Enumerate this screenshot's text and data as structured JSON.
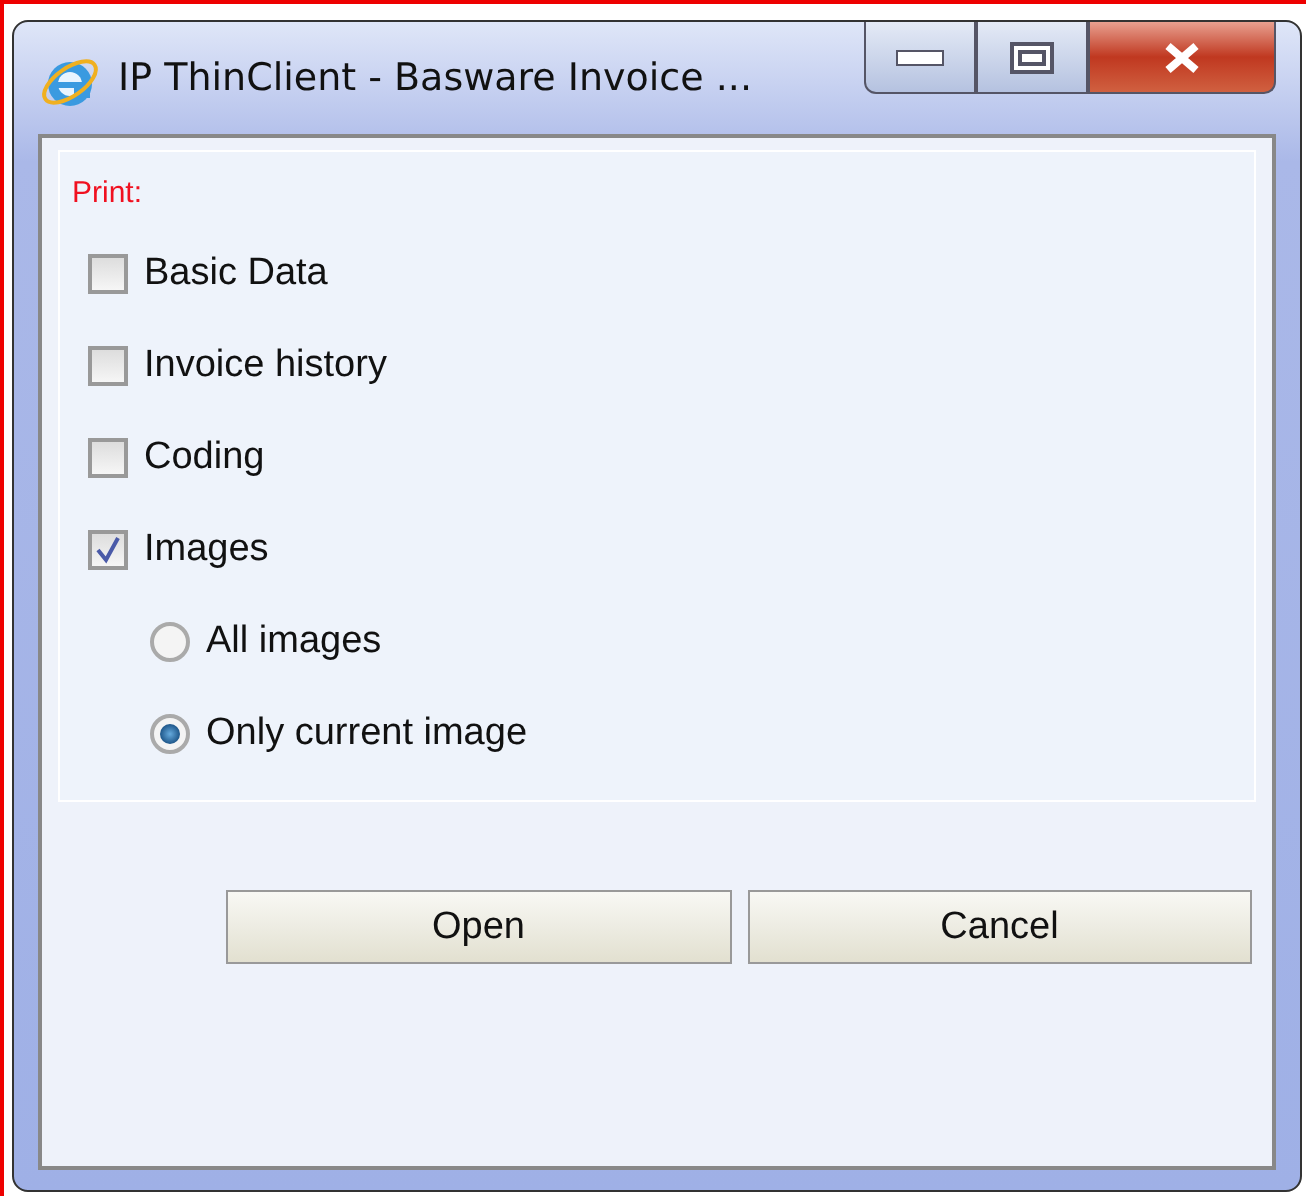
{
  "window": {
    "title": "IP ThinClient - Basware Invoice ..."
  },
  "section_label": "Print:",
  "options": [
    {
      "kind": "checkbox",
      "label": "Basic Data",
      "checked": false
    },
    {
      "kind": "checkbox",
      "label": "Invoice history",
      "checked": false
    },
    {
      "kind": "checkbox",
      "label": "Coding",
      "checked": false
    },
    {
      "kind": "checkbox",
      "label": "Images",
      "checked": true,
      "children": [
        {
          "kind": "radio",
          "label": "All images",
          "selected": false
        },
        {
          "kind": "radio",
          "label": "Only current image",
          "selected": true
        }
      ]
    }
  ],
  "buttons": [
    "Open",
    "Cancel"
  ]
}
